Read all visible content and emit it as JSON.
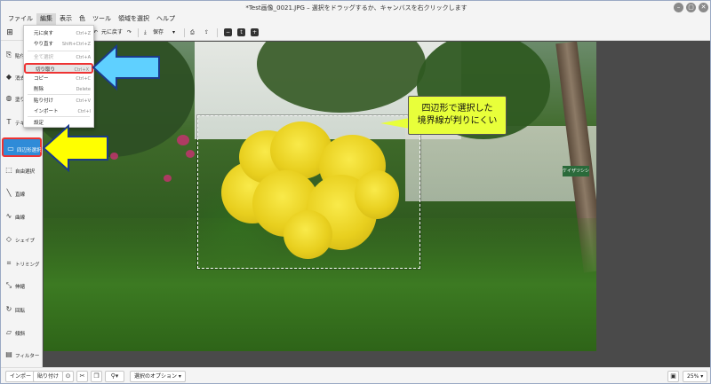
{
  "window": {
    "title": "*Test画像_0021.JPG – 選択をドラッグするか、キャンバスを右クリックします"
  },
  "menubar": {
    "items": [
      "ファイル",
      "編集",
      "表示",
      "色",
      "ツール",
      "領域を選択",
      "ヘルプ"
    ]
  },
  "toolbar": {
    "undo_label": "元に戻す",
    "save_label": "保存"
  },
  "edit_menu": {
    "items": [
      {
        "label": "元に戻す",
        "shortcut": "Ctrl+Z"
      },
      {
        "label": "やり直す",
        "shortcut": "Shift+Ctrl+Z"
      },
      {
        "label": "全て選択",
        "shortcut": "Ctrl+A"
      },
      {
        "label": "切り取り",
        "shortcut": "Ctrl+X"
      },
      {
        "label": "コピー",
        "shortcut": "Ctrl+C"
      },
      {
        "label": "削除",
        "shortcut": "Delete"
      },
      {
        "label": "貼り付け",
        "shortcut": "Ctrl+V"
      },
      {
        "label": "インポート",
        "shortcut": "Ctrl+I"
      },
      {
        "label": "設定",
        "shortcut": ""
      }
    ]
  },
  "sidebar": {
    "tools": [
      {
        "label": "貼付",
        "icon": "paste-icon"
      },
      {
        "label": "消去",
        "icon": "eraser-icon"
      },
      {
        "label": "塗り",
        "icon": "fill-icon"
      },
      {
        "label": "テキ",
        "icon": "text-icon"
      },
      {
        "label": "四辺形選択",
        "icon": "rect-select-icon"
      },
      {
        "label": "自由選択",
        "icon": "free-select-icon"
      },
      {
        "label": "直線",
        "icon": "line-icon"
      },
      {
        "label": "曲線",
        "icon": "curve-icon"
      },
      {
        "label": "シェイプ",
        "icon": "shape-icon"
      },
      {
        "label": "トリミング",
        "icon": "crop-icon"
      },
      {
        "label": "伸縮",
        "icon": "resize-icon"
      },
      {
        "label": "回転",
        "icon": "rotate-icon"
      },
      {
        "label": "傾斜",
        "icon": "skew-icon"
      },
      {
        "label": "フィルター",
        "icon": "filter-icon"
      }
    ],
    "selected_index": 4
  },
  "callout": {
    "line1": "四辺形で選択した",
    "line2": "境界線が判りにくい"
  },
  "photo": {
    "sign_text": "ケイザツシシ"
  },
  "statusbar": {
    "import_label": "インポート",
    "paste_label": "貼り付け",
    "options_label": "選択のオプション",
    "zoom": "25%"
  },
  "colors": {
    "accent": "#2f8bd8",
    "highlight_border": "#e33333",
    "callout_bg": "#e8ff3a",
    "arrow_blue": "#5fd0ff",
    "arrow_yellow": "#ffff00"
  }
}
